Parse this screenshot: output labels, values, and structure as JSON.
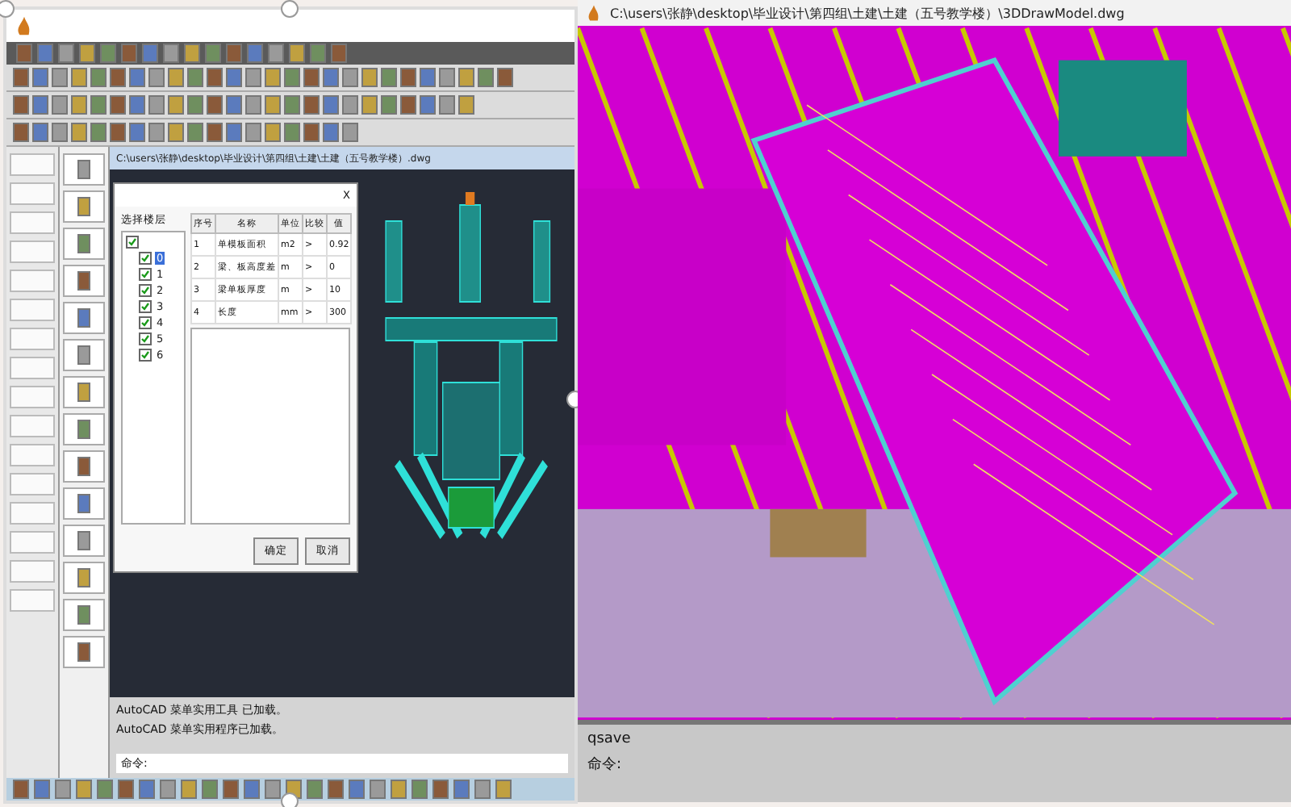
{
  "left_window": {
    "drawing_title": "C:\\users\\张静\\desktop\\毕业设计\\第四组\\土建\\土建（五号教学楼）.dwg",
    "dialog": {
      "close": "X",
      "floor_label": "选择楼层",
      "tree": {
        "checked": true,
        "children": [
          {
            "label": "0",
            "checked": true,
            "selected": true
          },
          {
            "label": "1",
            "checked": true,
            "selected": false
          },
          {
            "label": "2",
            "checked": true,
            "selected": false
          },
          {
            "label": "3",
            "checked": true,
            "selected": false
          },
          {
            "label": "4",
            "checked": true,
            "selected": false
          },
          {
            "label": "5",
            "checked": true,
            "selected": false
          },
          {
            "label": "6",
            "checked": true,
            "selected": false
          }
        ]
      },
      "table": {
        "columns": [
          "序号",
          "名称",
          "单位",
          "比较",
          "值"
        ],
        "rows": [
          [
            "1",
            "单模板面积",
            "m2",
            ">",
            "0.92"
          ],
          [
            "2",
            "梁、板高度差",
            "m",
            ">",
            "0"
          ],
          [
            "3",
            "梁单板厚度",
            "m",
            ">",
            "10"
          ],
          [
            "4",
            "长度",
            "mm",
            ">",
            "300"
          ]
        ]
      },
      "buttons": [
        "确定",
        "取消"
      ]
    },
    "command_lines": [
      "AutoCAD 菜单实用工具 已加载。",
      "AutoCAD 菜单实用程序已加载。"
    ],
    "prompt": "命令:"
  },
  "right_window": {
    "title": "C:\\users\\张静\\desktop\\毕业设计\\第四组\\土建\\土建（五号教学楼）\\3DDrawModel.dwg",
    "command_lines": [
      "qsave",
      "命令:"
    ]
  }
}
